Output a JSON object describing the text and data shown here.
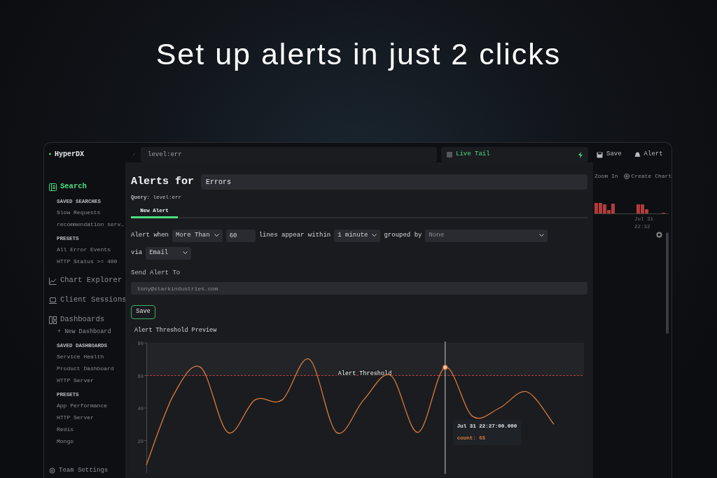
{
  "headline": "Set up alerts in just 2 clicks",
  "app": {
    "sidebar": {
      "logo": "HyperDX",
      "nav": [
        {
          "kind": "group",
          "label": "Search",
          "selected": true,
          "expanded": true,
          "groups": [
            {
              "heading": "SAVED SEARCHES",
              "items": [
                "Slow Requests",
                "recommendation serv…"
              ]
            },
            {
              "heading": "PRESETS",
              "items": [
                "All Error Events",
                "HTTP Status >= 400"
              ]
            }
          ]
        },
        {
          "kind": "link",
          "label": "Chart Explorer",
          "selected": false
        },
        {
          "kind": "link",
          "label": "Client Sessions",
          "selected": false
        },
        {
          "kind": "group",
          "label": "Dashboards",
          "selected": false,
          "expanded": true,
          "action": "+ New Dashboard",
          "groups": [
            {
              "heading": "SAVED DASHBOARDS",
              "items": [
                "Service Health",
                "Product Dashboard",
                "HTTP Server"
              ]
            },
            {
              "heading": "PRESETS",
              "items": [
                "App Performance",
                "HTTP Server",
                "Redis",
                "Mongo"
              ]
            }
          ]
        }
      ],
      "footer": "Team Settings"
    },
    "topbar": {
      "query": "level:err",
      "live_tail": {
        "label": "Live Tail",
        "checked": false
      },
      "buttons": [
        {
          "kind": "save",
          "label": "Save"
        },
        {
          "kind": "alert",
          "label": "Alert"
        }
      ]
    },
    "background": {
      "actions": [
        {
          "kind": "zoom",
          "label": "Zoom In"
        },
        {
          "kind": "create",
          "label": "Create Chart"
        }
      ],
      "time_label": "Jul 31 22:32"
    },
    "modal": {
      "title": "Alerts for",
      "name": "Errors",
      "query": "**Query:** level:err",
      "tabs": [
        {
          "label": "New Alert",
          "selected": true
        }
      ],
      "condition": [
        {
          "kind": "text",
          "text": "Alert when"
        },
        {
          "kind": "select",
          "value": "More Than"
        },
        {
          "kind": "input",
          "value": "60"
        },
        {
          "kind": "text",
          "text": "lines appear within"
        },
        {
          "kind": "select",
          "value": "1 minute"
        },
        {
          "kind": "text",
          "text": "grouped by"
        },
        {
          "kind": "wideselect",
          "value": "None"
        }
      ],
      "channel": {
        "label": "via",
        "value": "Email"
      },
      "recipient_label": "Send Alert To",
      "recipient_placeholder": "tony@starkindustries.com",
      "save": "Save",
      "preview": {
        "title": "Alert Threshold Preview",
        "chart_data": {
          "type": "line",
          "ylim": [
            0,
            80
          ],
          "yticks": [
            20,
            40,
            60,
            80
          ],
          "series": [
            {
              "color": "#d97b3f",
              "values": [
                5,
                48,
                65,
                25,
                45,
                45,
                70,
                25,
                45,
                60,
                25,
                65,
                35,
                40,
                50,
                30
              ]
            }
          ],
          "ref_lines": [
            {
              "axis": "y",
              "value": 60,
              "label": "Alert Threshold",
              "color": "#c03a3a"
            }
          ],
          "bands": [
            {
              "axis": "y",
              "from": 60,
              "to": 80,
              "color": "#232428"
            }
          ]
        },
        "tooltip": {
          "time": "Jul 31 22:27:00.000",
          "value": "count: 65"
        }
      }
    }
  }
}
